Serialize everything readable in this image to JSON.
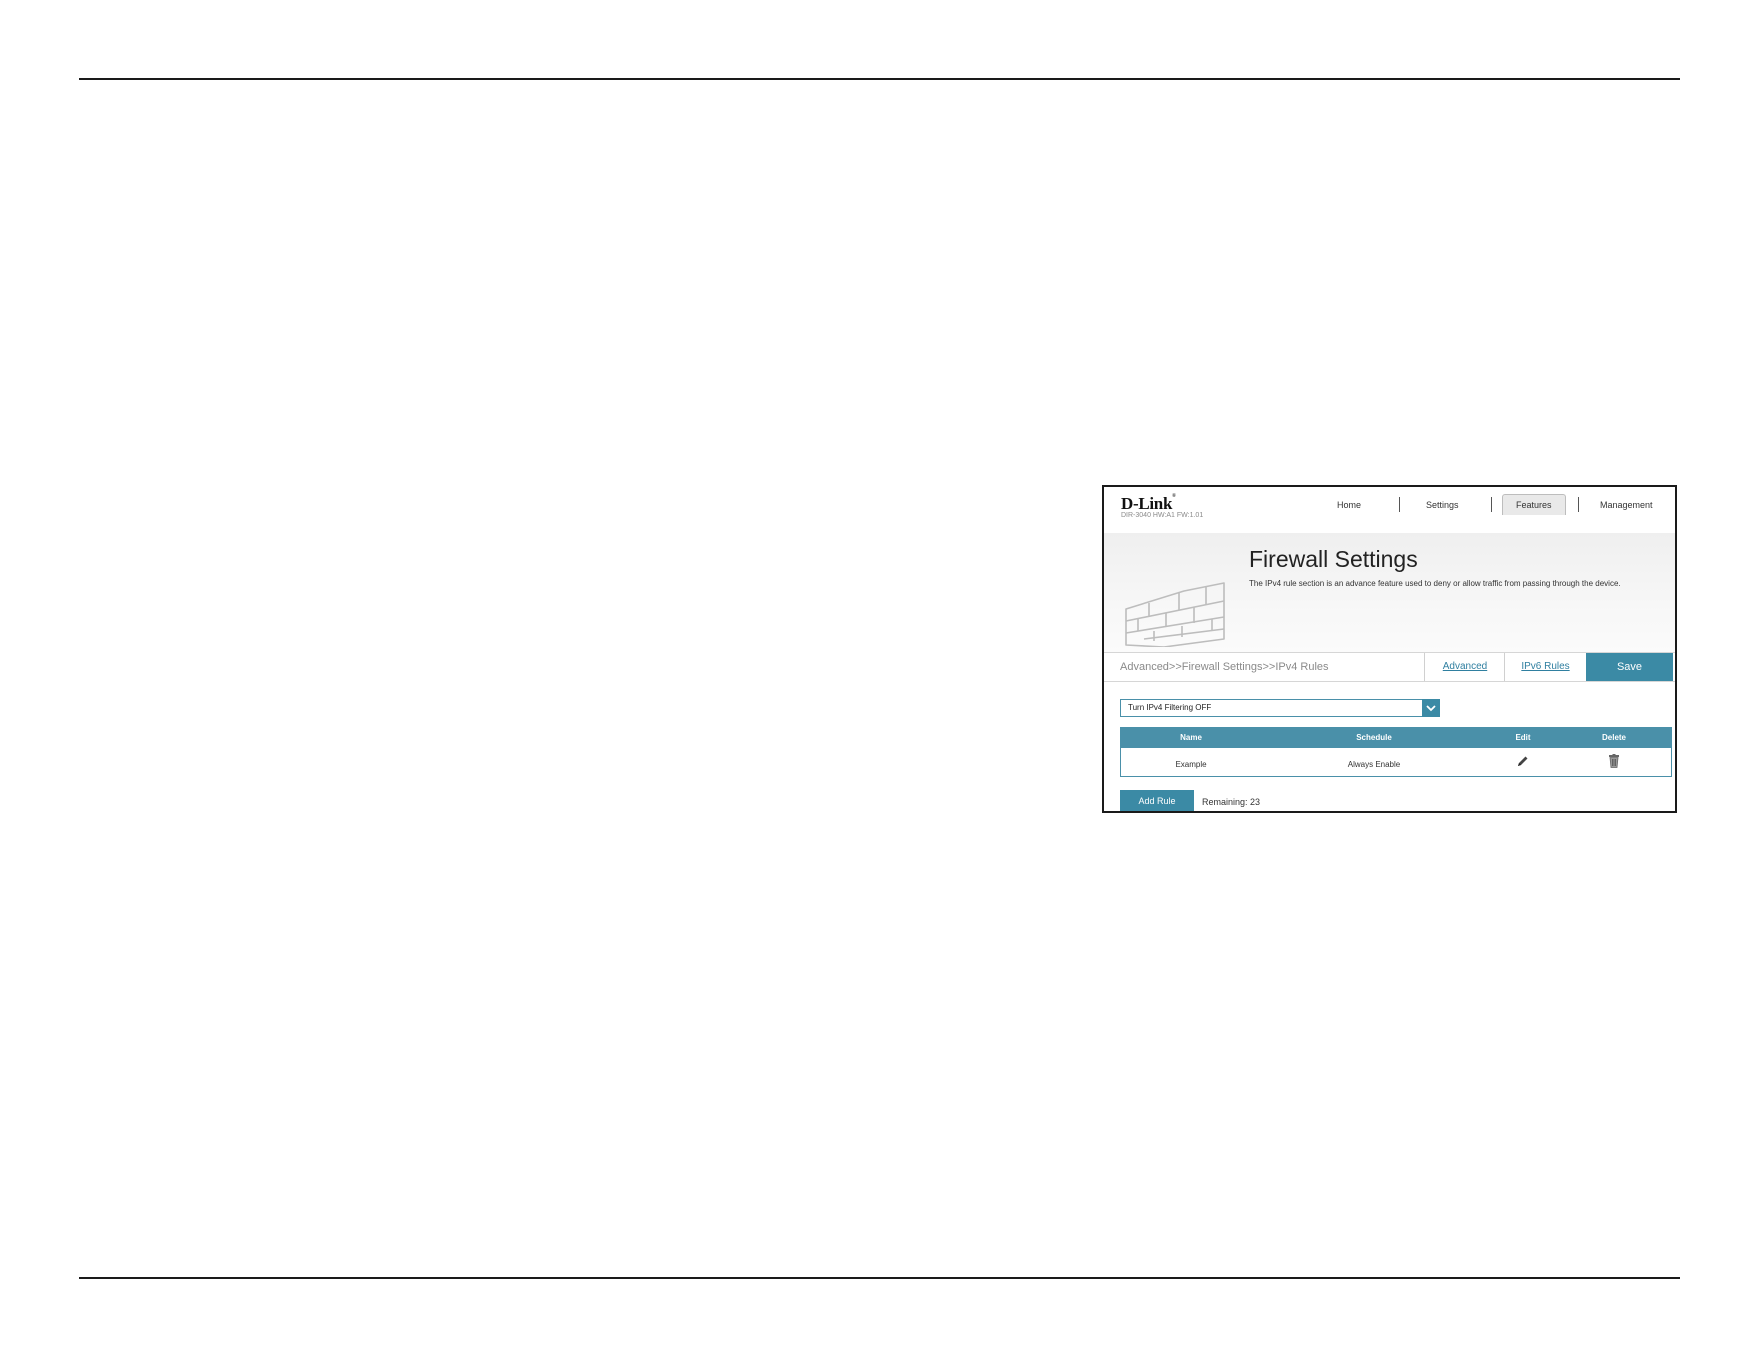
{
  "nav": {
    "brand": "D-Link",
    "model": "DIR-3040 HW:A1 FW:1.01",
    "items": [
      "Home",
      "Settings",
      "Features",
      "Management"
    ],
    "active": "Features"
  },
  "banner": {
    "title": "Firewall Settings",
    "description": "The IPv4 rule section is an advance feature used to deny or allow traffic from passing through the device."
  },
  "breadcrumb": "Advanced>>Firewall Settings>>IPv4 Rules",
  "tabs": {
    "advanced": "Advanced",
    "ipv6_rules": "IPv6 Rules",
    "save": "Save"
  },
  "filter_select": {
    "value": "Turn IPv4 Filtering OFF"
  },
  "table": {
    "headers": [
      "Name",
      "Schedule",
      "Edit",
      "Delete"
    ],
    "rows": [
      {
        "name": "Example",
        "schedule": "Always Enable"
      }
    ]
  },
  "add_rule_label": "Add Rule",
  "remaining": "Remaining: 23",
  "colors": {
    "accent": "#3b8aa5",
    "table_header": "#4a90a9",
    "link": "#2f7fa0"
  }
}
